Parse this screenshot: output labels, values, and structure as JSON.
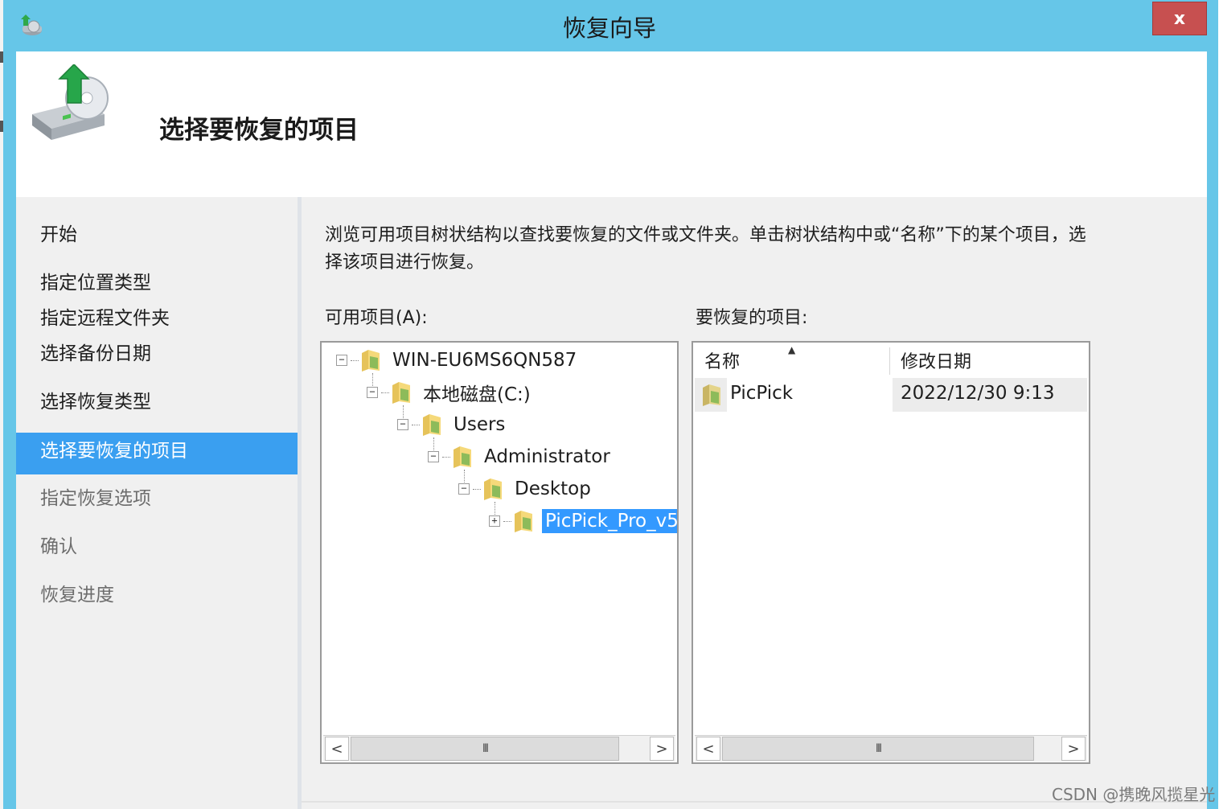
{
  "window": {
    "title": "恢复向导",
    "close_label": "x",
    "accent_color": "#66c6e8"
  },
  "header": {
    "title": "选择要恢复的项目",
    "icon": "restore-disk-icon"
  },
  "nav": {
    "items": [
      {
        "label": "开始",
        "state": "done"
      },
      {
        "label": "指定位置类型",
        "state": "done"
      },
      {
        "label": "指定远程文件夹",
        "state": "done"
      },
      {
        "label": "选择备份日期",
        "state": "done"
      },
      {
        "label": "选择恢复类型",
        "state": "done"
      },
      {
        "label": "选择要恢复的项目",
        "state": "current"
      },
      {
        "label": "指定恢复选项",
        "state": "future"
      },
      {
        "label": "确认",
        "state": "future"
      },
      {
        "label": "恢复进度",
        "state": "future"
      }
    ]
  },
  "main": {
    "description": "浏览可用项目树状结构以查找要恢复的文件或文件夹。单击树状结构中或“名称”下的某个项目，选择该项目进行恢复。",
    "available_label": "可用项目(A):",
    "restore_label": "要恢复的项目:",
    "tree": [
      {
        "label": "WIN-EU6MS6QN587",
        "expander": "⊟"
      },
      {
        "label": "本地磁盘(C:)",
        "expander": "⊟"
      },
      {
        "label": "Users",
        "expander": "⊟"
      },
      {
        "label": "Administrator",
        "expander": "⊟"
      },
      {
        "label": "Desktop",
        "expander": "⊟"
      },
      {
        "label": "PicPick_Pro_v5",
        "expander": "⊞",
        "selected": true
      }
    ],
    "table": {
      "columns": [
        "名称",
        "修改日期"
      ],
      "sort_indicator": "▲",
      "rows": [
        {
          "name": "PicPick",
          "modified": "2022/12/30 9:13"
        }
      ]
    },
    "scroll_left": "<",
    "scroll_right": ">",
    "scroll_grip": "III"
  },
  "watermark": "CSDN @携晚风揽星光"
}
